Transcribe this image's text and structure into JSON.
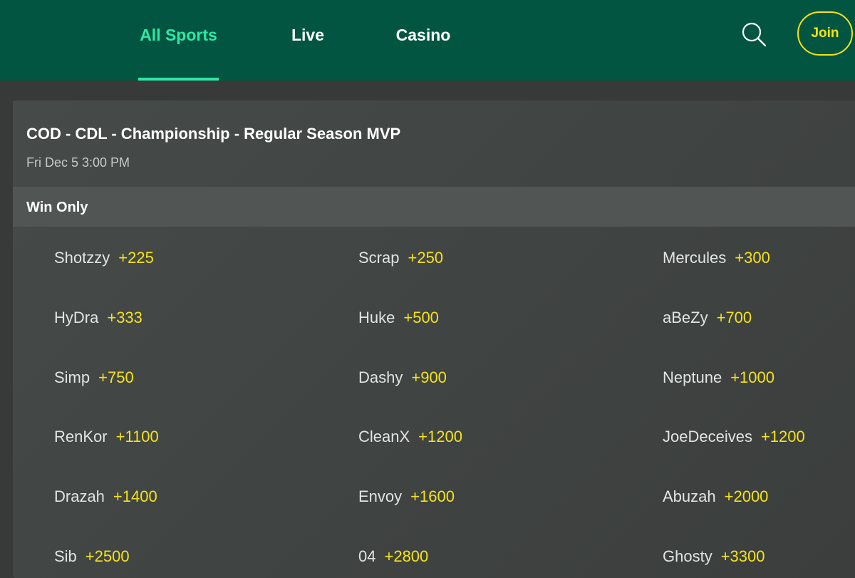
{
  "nav": {
    "tabs": [
      {
        "label": "All Sports",
        "active": true
      },
      {
        "label": "Live",
        "active": false
      },
      {
        "label": "Casino",
        "active": false
      }
    ],
    "search_icon": "search-icon",
    "join_label": "Join"
  },
  "colors": {
    "header_bg": "#025641",
    "active_tab": "#2ee8a5",
    "odds": "#f4e31a",
    "page_bg": "#383a39",
    "market_header_bg": "#515654"
  },
  "event": {
    "title": "COD - CDL - Championship - Regular Season MVP",
    "date": "Fri Dec 5 3:00 PM"
  },
  "market": {
    "label": "Win Only",
    "outcomes": [
      {
        "name": "Shotzzy",
        "price": "+225"
      },
      {
        "name": "Scrap",
        "price": "+250"
      },
      {
        "name": "Mercules",
        "price": "+300"
      },
      {
        "name": "HyDra",
        "price": "+333"
      },
      {
        "name": "Huke",
        "price": "+500"
      },
      {
        "name": "aBeZy",
        "price": "+700"
      },
      {
        "name": "Simp",
        "price": "+750"
      },
      {
        "name": "Dashy",
        "price": "+900"
      },
      {
        "name": "Neptune",
        "price": "+1000"
      },
      {
        "name": "RenKor",
        "price": "+1100"
      },
      {
        "name": "CleanX",
        "price": "+1200"
      },
      {
        "name": "JoeDeceives",
        "price": "+1200"
      },
      {
        "name": "Drazah",
        "price": "+1400"
      },
      {
        "name": "Envoy",
        "price": "+1600"
      },
      {
        "name": "Abuzah",
        "price": "+2000"
      },
      {
        "name": "Sib",
        "price": "+2500"
      },
      {
        "name": "04",
        "price": "+2800"
      },
      {
        "name": "Ghosty",
        "price": "+3300"
      }
    ]
  }
}
